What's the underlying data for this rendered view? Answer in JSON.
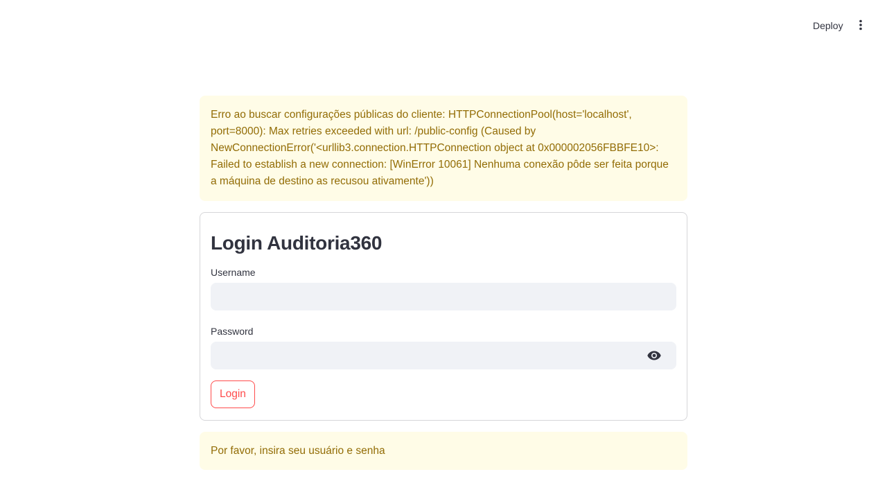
{
  "header": {
    "deploy_label": "Deploy",
    "menu_icon": "vertical-dots-icon"
  },
  "alerts": {
    "config_error": "Erro ao buscar configurações públicas do cliente: HTTPConnectionPool(host='localhost', port=8000): Max retries exceeded with url: /public-config (Caused by NewConnectionError('<urllib3.connection.HTTPConnection object at 0x000002056FBBFE10>: Failed to establish a new connection: [WinError 10061] Nenhuma conexão pôde ser feita porque a máquina de destino as recusou ativamente'))",
    "hint": "Por favor, insira seu usuário e senha"
  },
  "form": {
    "title": "Login Auditoria360",
    "username_label": "Username",
    "username_value": "",
    "password_label": "Password",
    "password_value": "",
    "password_toggle_icon": "eye-icon",
    "submit_label": "Login"
  },
  "colors": {
    "accent": "#ff4b4b",
    "warning_bg": "#fffce7",
    "warning_text": "#926c05",
    "input_bg": "#f0f2f6"
  }
}
